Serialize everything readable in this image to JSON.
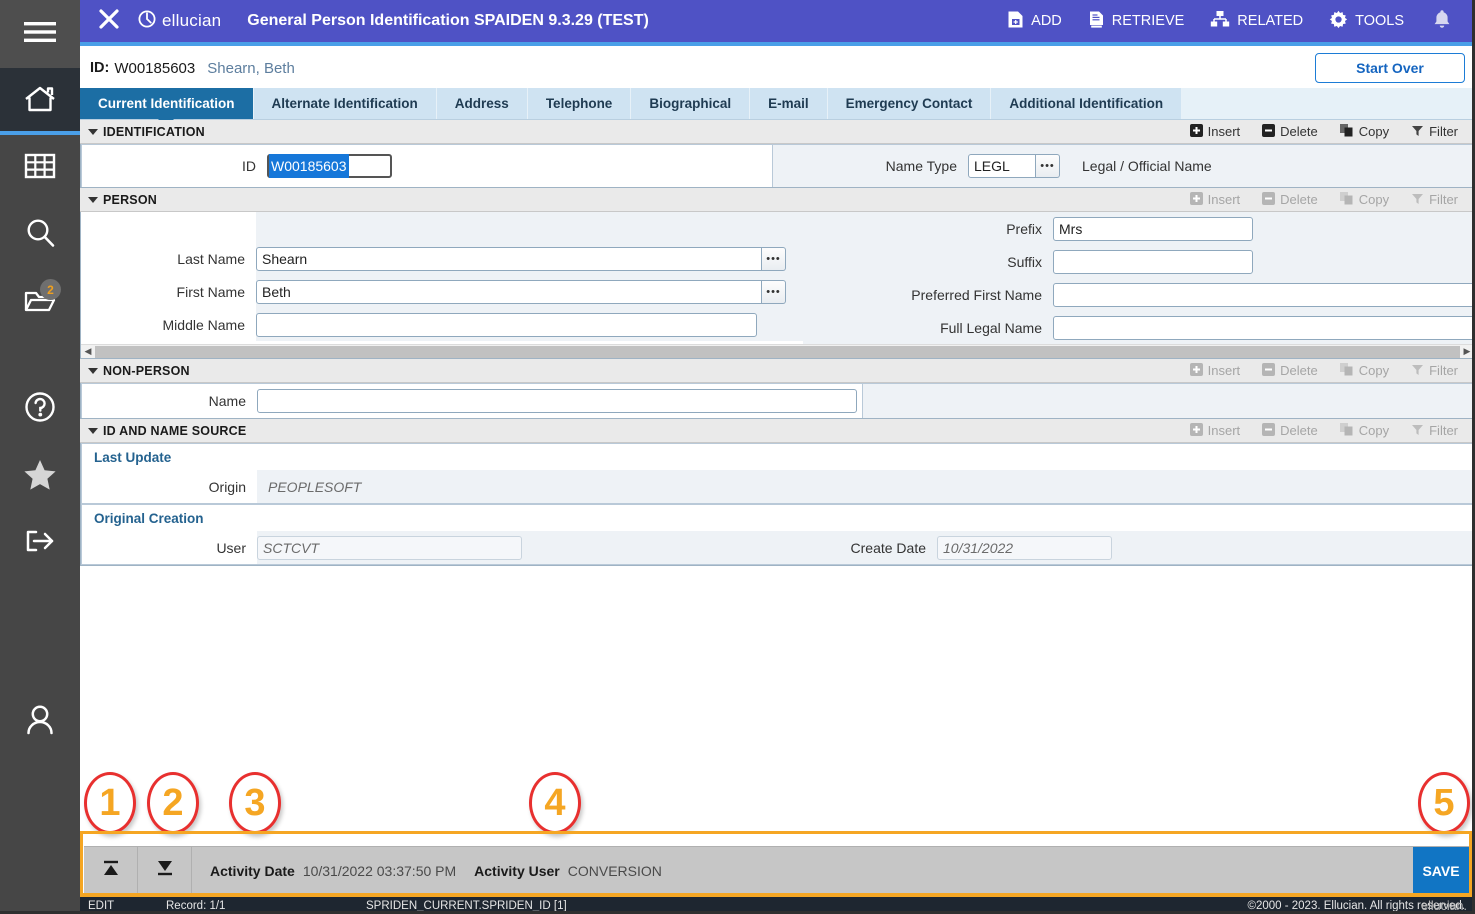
{
  "window": {
    "close_label": "✕",
    "brand": "ellucian",
    "title": "General Person Identification SPAIDEN 9.3.29 (TEST)"
  },
  "toolbar": {
    "actions": [
      {
        "label": "ADD",
        "icon": "add-document-icon"
      },
      {
        "label": "RETRIEVE",
        "icon": "retrieve-document-icon"
      },
      {
        "label": "RELATED",
        "icon": "related-hierarchy-icon"
      },
      {
        "label": "TOOLS",
        "icon": "gear-icon"
      }
    ],
    "notification_icon": "bell-icon"
  },
  "sidebar": {
    "items": [
      {
        "name": "menu",
        "icon": "hamburger-icon"
      },
      {
        "name": "home",
        "icon": "home-icon",
        "active": true
      },
      {
        "name": "applications",
        "icon": "grid-icon"
      },
      {
        "name": "search",
        "icon": "search-icon"
      },
      {
        "name": "recently-opened",
        "icon": "folder-icon",
        "badge": "2"
      },
      {
        "name": "help",
        "icon": "question-circle-icon"
      },
      {
        "name": "favorites",
        "icon": "star-icon"
      },
      {
        "name": "sign-out",
        "icon": "sign-out-icon"
      },
      {
        "name": "my-profile",
        "icon": "person-icon"
      }
    ]
  },
  "record_header": {
    "id_label": "ID:",
    "id_value": "W00185603",
    "person_name": "Shearn, Beth",
    "start_over_label": "Start Over"
  },
  "tabs": [
    {
      "label": "Current Identification",
      "active": true
    },
    {
      "label": "Alternate Identification",
      "active": false
    },
    {
      "label": "Address",
      "active": false
    },
    {
      "label": "Telephone",
      "active": false
    },
    {
      "label": "Biographical",
      "active": false
    },
    {
      "label": "E-mail",
      "active": false
    },
    {
      "label": "Emergency Contact",
      "active": false
    },
    {
      "label": "Additional Identification",
      "active": false
    }
  ],
  "section_tools": {
    "insert": "Insert",
    "delete": "Delete",
    "copy": "Copy",
    "filter": "Filter"
  },
  "sections": {
    "identification": {
      "title": "IDENTIFICATION",
      "id_label": "ID",
      "id_value": "W00185603",
      "name_type_label": "Name Type",
      "name_type_value": "LEGL",
      "name_type_desc": "Legal / Official Name"
    },
    "person": {
      "title": "PERSON",
      "last_name_label": "Last Name",
      "last_name_value": "Shearn",
      "first_name_label": "First Name",
      "first_name_value": "Beth",
      "middle_name_label": "Middle Name",
      "middle_name_value": "",
      "prefix_label": "Prefix",
      "prefix_value": "Mrs",
      "suffix_label": "Suffix",
      "suffix_value": "",
      "preferred_first_name_label": "Preferred First Name",
      "preferred_first_name_value": "",
      "full_legal_name_label": "Full Legal Name",
      "full_legal_name_value": ""
    },
    "non_person": {
      "title": "NON-PERSON",
      "name_label": "Name",
      "name_value": ""
    },
    "id_and_name_source": {
      "title": "ID AND NAME SOURCE",
      "last_update_label": "Last Update",
      "origin_label": "Origin",
      "origin_value": "PEOPLESOFT",
      "original_creation_label": "Original Creation",
      "user_label": "User",
      "user_value": "SCTCVT",
      "create_date_label": "Create Date",
      "create_date_value": "10/31/2022"
    }
  },
  "bottom_bar": {
    "first_record_icon": "go-to-first-icon",
    "last_record_icon": "go-to-last-icon",
    "activity_date_label": "Activity Date",
    "activity_date_value": "10/31/2022 03:37:50 PM",
    "activity_user_label": "Activity User",
    "activity_user_value": "CONVERSION",
    "save_label": "SAVE"
  },
  "status_bar": {
    "mode": "EDIT",
    "record": "Record: 1/1",
    "block": "SPRIDEN_CURRENT.SPRIDEN_ID [1]",
    "copyright": "©2000 - 2023. Ellucian. All rights reserved.",
    "logo": "ellucian."
  },
  "callouts": [
    {
      "number": "1"
    },
    {
      "number": "2"
    },
    {
      "number": "3"
    },
    {
      "number": "4"
    },
    {
      "number": "5"
    }
  ],
  "colors": {
    "brand_purple": "#4f52c5",
    "accent_blue": "#4a9fe8",
    "tab_active": "#1c6ea4",
    "callout_ring": "#e8302f",
    "callout_number": "#f5a623",
    "save_blue": "#1175c4"
  }
}
